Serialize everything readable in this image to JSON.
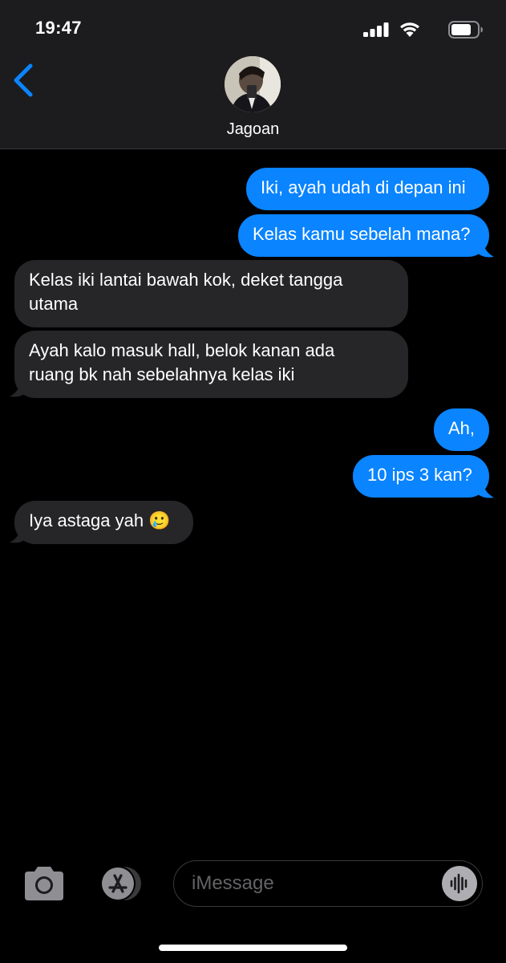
{
  "status_bar": {
    "time": "19:47"
  },
  "header": {
    "contact_name": "Jagoan"
  },
  "messages": [
    {
      "side": "sent",
      "lines": [
        "Iki, ayah udah di depan ini"
      ]
    },
    {
      "side": "sent",
      "lines": [
        "Kelas kamu sebelah mana?"
      ]
    },
    {
      "side": "received",
      "lines": [
        "Kelas iki lantai bawah kok, deket tangga",
        "utama"
      ]
    },
    {
      "side": "received",
      "lines": [
        "Ayah kalo masuk hall, belok kanan ada",
        "ruang bk nah sebelahnya kelas iki"
      ]
    },
    {
      "side": "sent",
      "lines": [
        "Ah,"
      ]
    },
    {
      "side": "sent",
      "lines": [
        "10 ips 3 kan?"
      ]
    },
    {
      "side": "received",
      "lines": [
        "Iya astaga yah 🥲"
      ]
    }
  ],
  "input_bar": {
    "placeholder": "iMessage"
  },
  "colors": {
    "sent_bubble": "#0a84ff",
    "received_bubble": "#262628",
    "accent": "#0a84ff"
  },
  "icons": [
    "signal-icon",
    "wifi-icon",
    "battery-icon",
    "back-chevron-icon",
    "camera-icon",
    "app-store-icon",
    "audio-waveform-icon"
  ]
}
